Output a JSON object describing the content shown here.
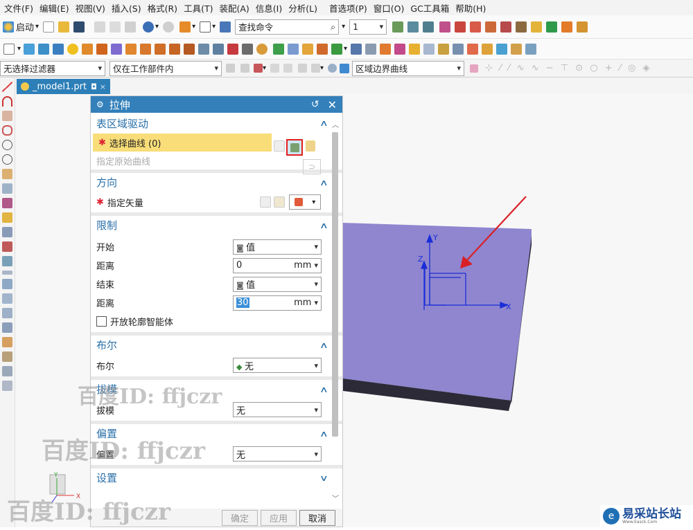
{
  "menu": [
    "文件(F)",
    "编辑(E)",
    "视图(V)",
    "插入(S)",
    "格式(R)",
    "工具(T)",
    "装配(A)",
    "信息(I)",
    "分析(L)",
    "首选项(P)",
    "窗口(O)",
    "GC工具箱",
    "帮助(H)"
  ],
  "toolbar": {
    "start_label": "启动",
    "command_search_placeholder": "查找命令",
    "number_field": "1"
  },
  "filterbar": {
    "type_filter": "无选择过滤器",
    "scope": "仅在工作部件内",
    "curve_rule": "区域边界曲线"
  },
  "tab": {
    "label": "_model1.prt"
  },
  "dialog": {
    "title": "拉伸",
    "sections": {
      "region": {
        "title": "表区域驱动",
        "select_curve": "选择曲线 (0)",
        "original_curve": "指定原始曲线"
      },
      "direction": {
        "title": "方向",
        "vector": "指定矢量"
      },
      "limits": {
        "title": "限制",
        "start_label": "开始",
        "start_value": "值",
        "start_dist_label": "距离",
        "start_dist": "0",
        "end_label": "结束",
        "end_value": "值",
        "end_dist_label": "距离",
        "end_dist": "30",
        "unit": "mm",
        "open_profile": "开放轮廓智能体"
      },
      "boolean": {
        "title": "布尔",
        "label": "布尔",
        "value": "无"
      },
      "draft": {
        "title": "拔模",
        "label": "拔模",
        "value": "无"
      },
      "offset": {
        "title": "偏置",
        "label": "偏置",
        "value": "无"
      },
      "settings": {
        "title": "设置"
      }
    },
    "buttons": {
      "ok": "确定",
      "apply": "应用",
      "cancel": "取消"
    }
  },
  "viewport": {
    "axis_x": "X",
    "axis_y": "Y",
    "axis_z": "Z",
    "block_color": "#8f86cf",
    "block_side": "#2c2a37"
  },
  "watermarks": {
    "wm1": "百度ID: ffjczr",
    "wm2": "百度ID: ffjczr",
    "wm3": "百度ID: ffjczr",
    "logo": "易采站长站",
    "logo_sub": "Www.Easck.Com"
  }
}
